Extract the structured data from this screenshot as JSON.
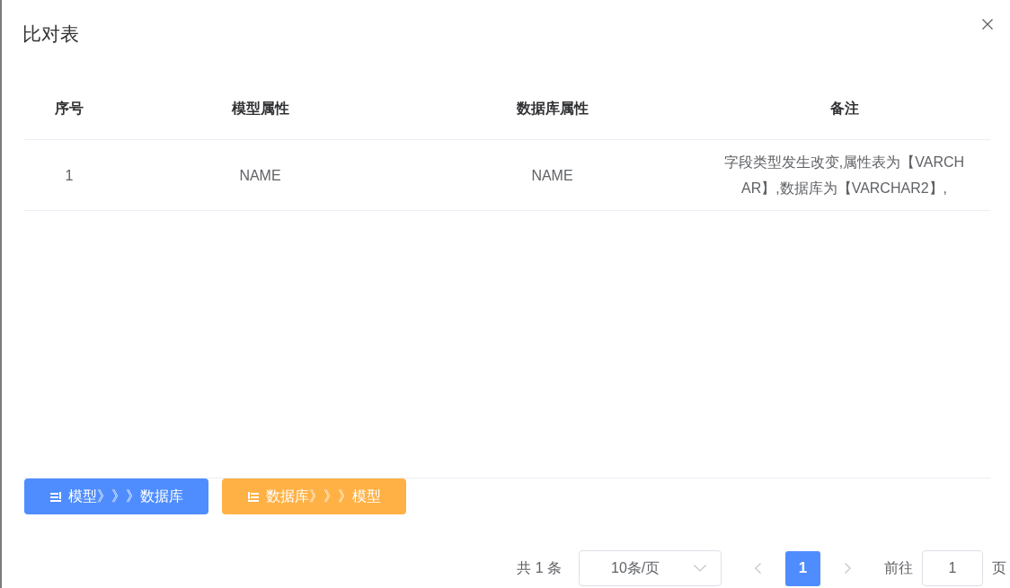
{
  "dialog": {
    "title": "比对表"
  },
  "table": {
    "columns": [
      "序号",
      "模型属性",
      "数据库属性",
      "备注"
    ],
    "rows": [
      [
        "1",
        "NAME",
        "NAME",
        "字段类型发生改变,属性表为【VARCHAR】,数据库为【VARCHAR2】,"
      ]
    ]
  },
  "buttons": [
    {
      "label": "模型》》》数据库",
      "kind": "primary"
    },
    {
      "label": "数据库》》》模型",
      "kind": "warning"
    }
  ],
  "pagination": {
    "total": "共 1 条",
    "page_size": "10条/页",
    "prev": {
      "disabled": true
    },
    "pages": [
      {
        "label": "1",
        "selected": true
      }
    ],
    "next": {
      "disabled": true
    },
    "goto_label": "前往",
    "goto_value": "1",
    "page_suffix": "页"
  }
}
